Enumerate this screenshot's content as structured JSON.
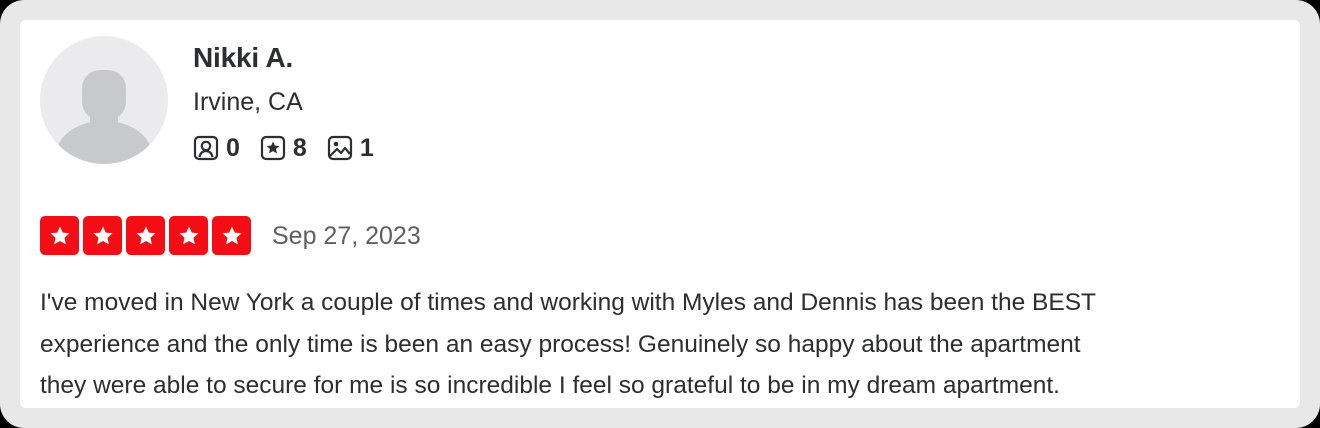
{
  "reviewer": {
    "name": "Nikki A.",
    "location": "Irvine, CA",
    "avatar_icon": "default-user-avatar-icon",
    "stats": [
      {
        "icon": "friends-icon",
        "count": "0"
      },
      {
        "icon": "reviews-star-icon",
        "count": "8"
      },
      {
        "icon": "photos-icon",
        "count": "1"
      }
    ]
  },
  "review": {
    "rating": 5,
    "max_rating": 5,
    "date": "Sep 27, 2023",
    "text_lines": [
      "I've moved in New York a couple of times and working with Myles and Dennis has been the BEST",
      "experience and the only time is been an easy process! Genuinely so happy about the apartment",
      "they were able to secure for me is so incredible I feel so grateful to be in my dream apartment."
    ]
  },
  "colors": {
    "star_fill": "#f40d15",
    "text": "#2d2e2f",
    "muted_text": "#5f5f5f",
    "avatar_bg": "#ebebed",
    "avatar_figure": "#c8c9ca"
  }
}
